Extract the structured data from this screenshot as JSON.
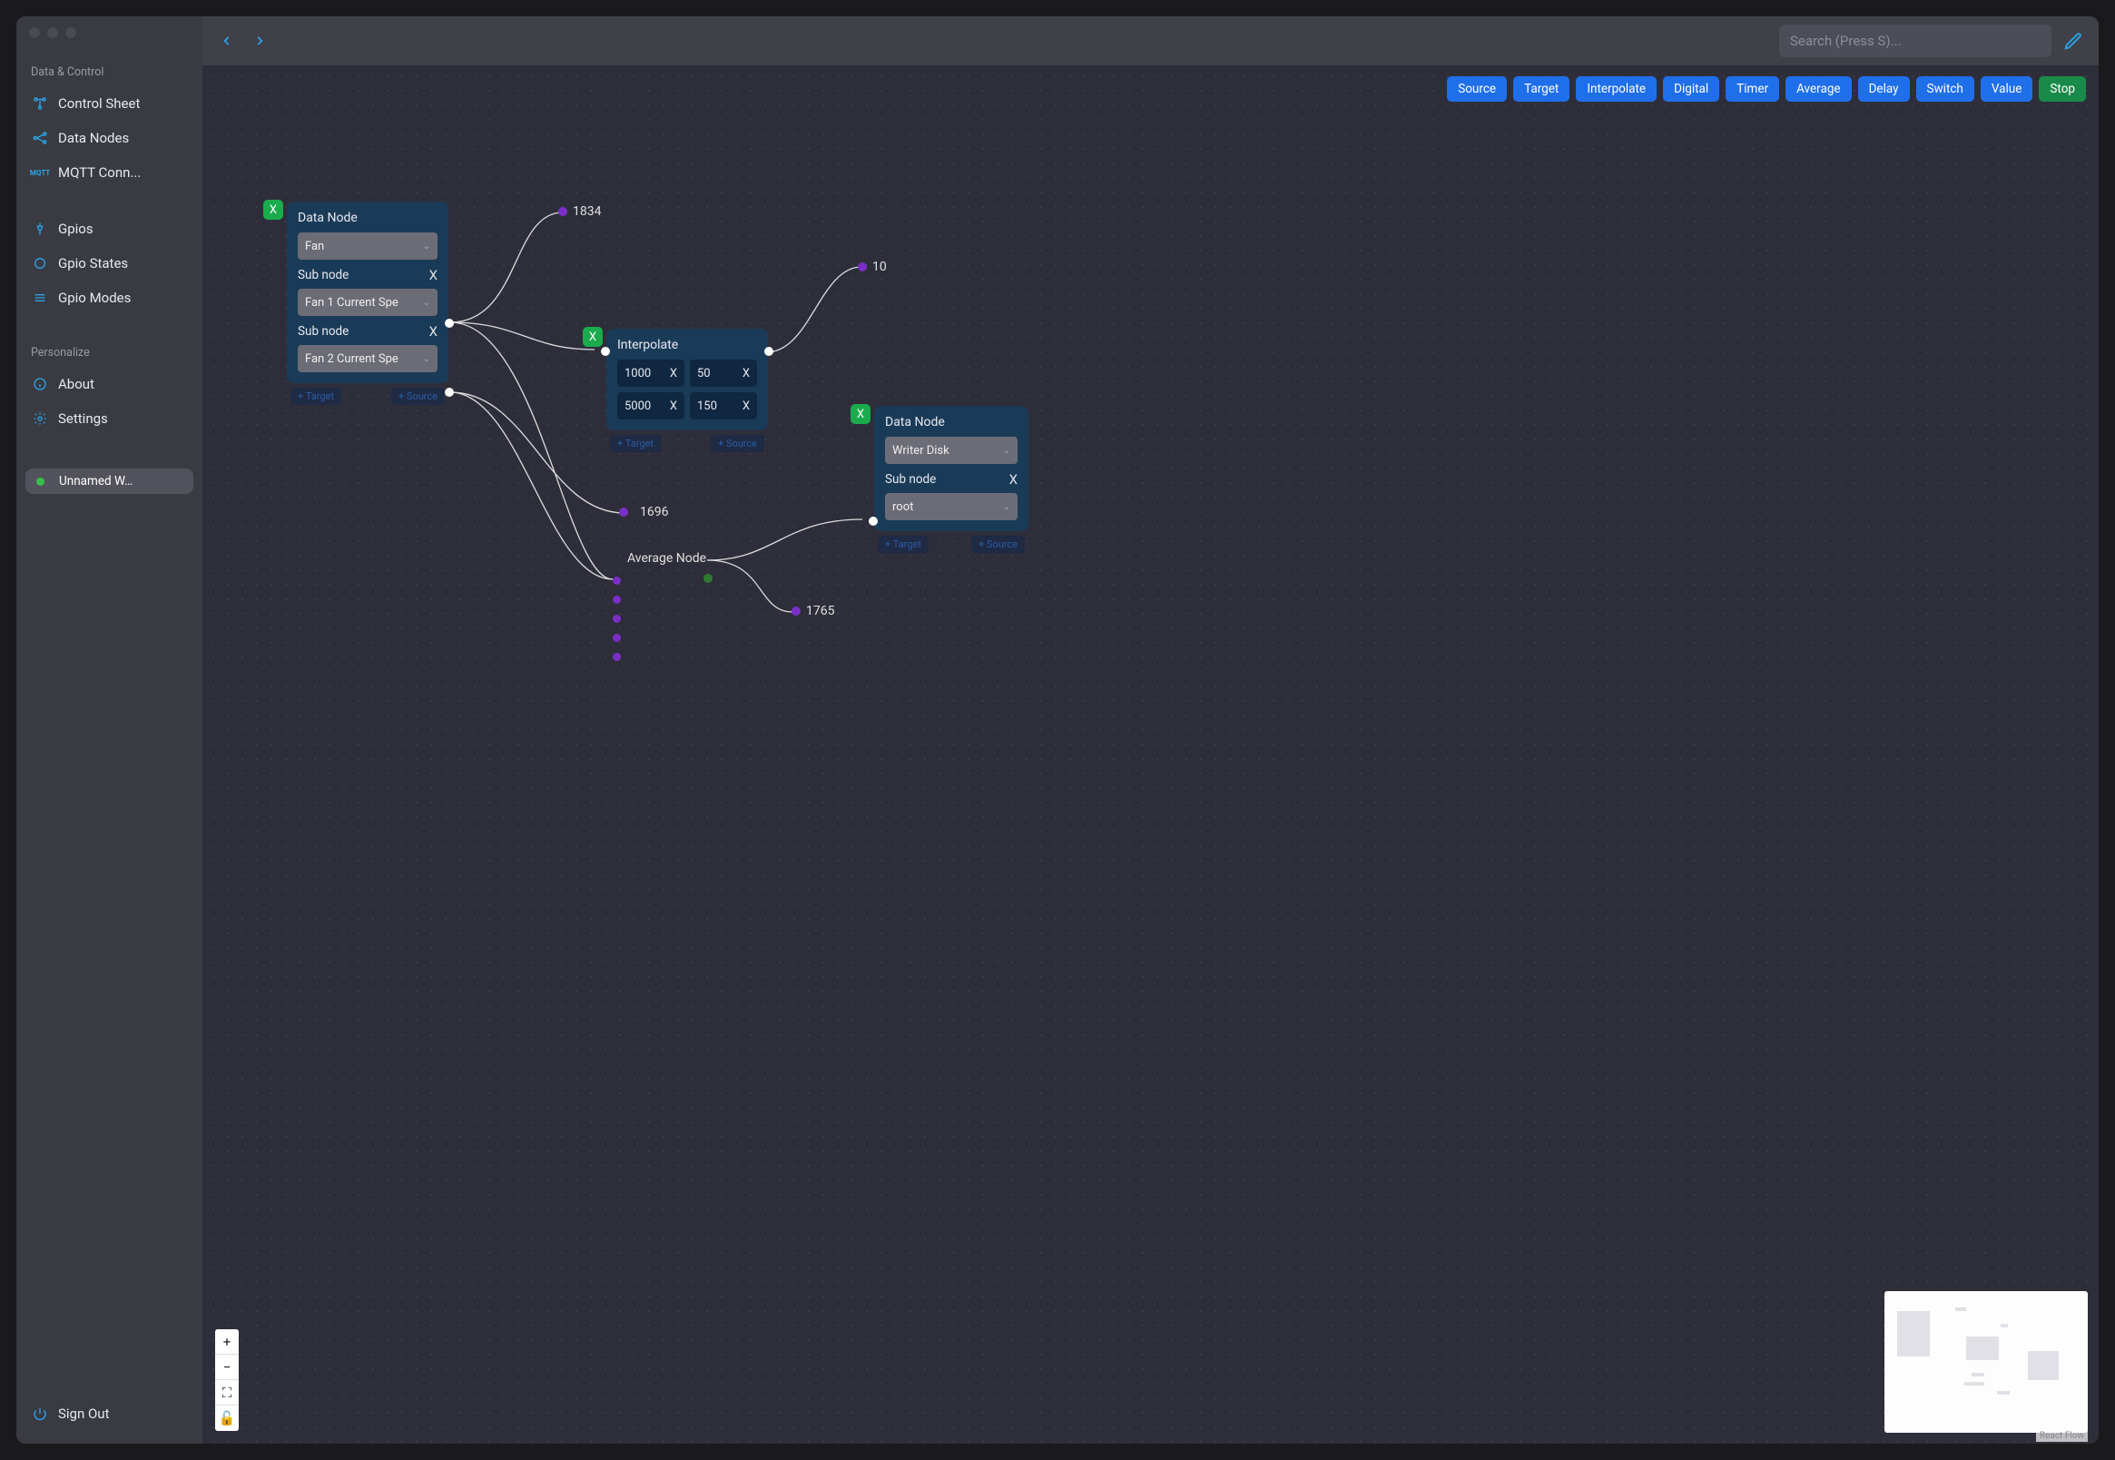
{
  "sidebar": {
    "section_data_control": "Data & Control",
    "control_sheet": "Control Sheet",
    "data_nodes": "Data Nodes",
    "mqtt": "MQTT Conn...",
    "gpios": "Gpios",
    "gpio_states": "Gpio States",
    "gpio_modes": "Gpio Modes",
    "section_personalize": "Personalize",
    "about": "About",
    "settings": "Settings",
    "workspace": "Unnamed W…",
    "signout": "Sign Out"
  },
  "topbar": {
    "search_placeholder": "Search (Press S)..."
  },
  "toolbar": {
    "source": "Source",
    "target": "Target",
    "interpolate": "Interpolate",
    "digital": "Digital",
    "timer": "Timer",
    "average": "Average",
    "delay": "Delay",
    "switch": "Switch",
    "value": "Value",
    "stop": "Stop"
  },
  "nodes": {
    "data1": {
      "title": "Data Node",
      "select": "Fan",
      "sub_label": "Sub node",
      "sub1": "Fan 1 Current Spe",
      "sub2": "Fan 2 Current Spe",
      "ghost_target": "+ Target",
      "ghost_source": "+ Source"
    },
    "interp": {
      "title": "Interpolate",
      "r1c1": "1000",
      "r1c2": "50",
      "r2c1": "5000",
      "r2c2": "150",
      "ghost_target": "+ Target",
      "ghost_source": "+ Source"
    },
    "data2": {
      "title": "Data Node",
      "select": "Writer Disk",
      "sub_label": "Sub node",
      "sub1": "root",
      "ghost_target": "+ Target",
      "ghost_source": "+ Source"
    },
    "avg": {
      "title": "Average Node"
    },
    "val_1834": "1834",
    "val_10": "10",
    "val_1696": "1696",
    "val_1765": "1765",
    "x": "X"
  },
  "minimap": {
    "attr": "React Flow"
  },
  "zoom": {
    "plus": "+",
    "minus": "−",
    "fit": "⛶",
    "lock": "🔓"
  }
}
